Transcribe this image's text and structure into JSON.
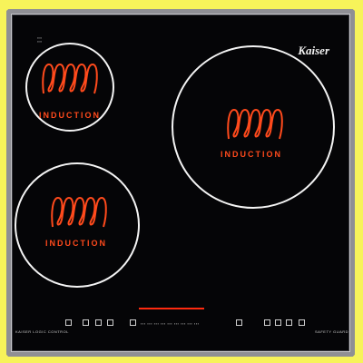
{
  "brand": "Kaiser",
  "zones": [
    {
      "label": "INDUCTION"
    },
    {
      "label": "INDUCTION"
    },
    {
      "label": "INDUCTION"
    }
  ],
  "footer": {
    "left": "KAISER LOGIC CONTROL",
    "right": "SAFETY GUARD"
  },
  "colors": {
    "coil": "#ff4a1c",
    "glass": "#050507",
    "background": "#f7f35a",
    "ring": "#f4f4f4"
  }
}
